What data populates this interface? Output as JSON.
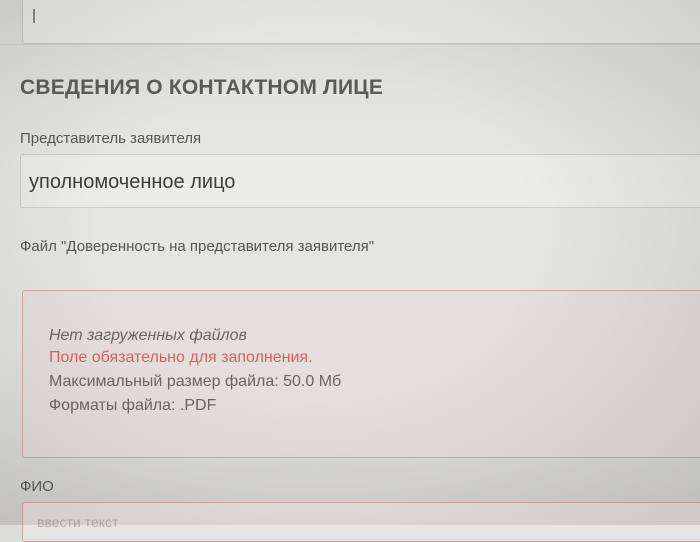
{
  "section": {
    "title": "СВЕДЕНИЯ О КОНТАКТНОМ ЛИЦЕ"
  },
  "representative": {
    "label": "Представитель заявителя",
    "value": "уполномоченное лицо"
  },
  "file_upload": {
    "label": "Файл \"Доверенность на представителя заявителя\"",
    "no_files": "Нет загруженных файлов",
    "required_error": "Поле обязательно для заполнения.",
    "max_size": "Максимальный размер файла: 50.0 Мб",
    "formats": "Форматы файла: .PDF"
  },
  "fio": {
    "label": "ФИО",
    "placeholder": "ввести текст"
  },
  "colors": {
    "error_text": "#d95f63",
    "error_border": "#d6a9a3",
    "heading": "#5a5a5a"
  }
}
